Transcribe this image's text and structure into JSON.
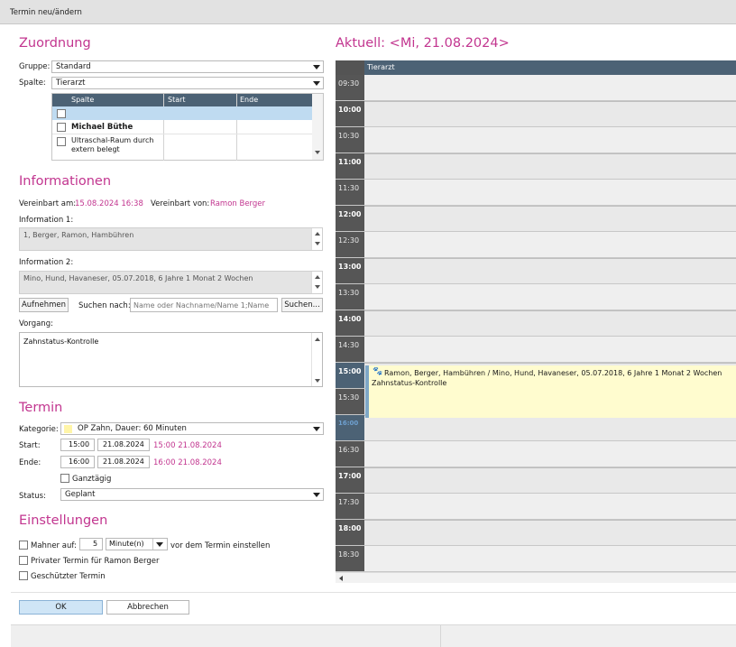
{
  "window": {
    "title": "Termin neu/ändern"
  },
  "zuordnung": {
    "heading": "Zuordnung",
    "gruppe_label": "Gruppe:",
    "gruppe_value": "Standard",
    "spalte_label": "Spalte:",
    "spalte_value": "Tierarzt",
    "table": {
      "headers": [
        "Spalte",
        "Start",
        "Ende"
      ],
      "rows": [
        {
          "name": "",
          "start": "",
          "ende": "",
          "checked": false,
          "selected": true,
          "bold": false
        },
        {
          "name": "Michael Büthe",
          "start": "",
          "ende": "",
          "checked": false,
          "selected": false,
          "bold": true
        },
        {
          "name": "Ultraschal-Raum durch extern belegt",
          "start": "",
          "ende": "",
          "checked": false,
          "selected": false,
          "bold": false
        }
      ]
    }
  },
  "informationen": {
    "heading": "Informationen",
    "vereinbart_am_label": "Vereinbart am:",
    "vereinbart_am_value": "15.08.2024 16:38",
    "vereinbart_von_label": "Vereinbart von:",
    "vereinbart_von_value": "Ramon Berger",
    "info1_label": "Information 1:",
    "info1_value": "1, Berger, Ramon, Hambühren",
    "info2_label": "Information 2:",
    "info2_value": "Mino, Hund, Havaneser, 05.07.2018, 6 Jahre 1 Monat 2 Wochen",
    "aufnehmen_label": "Aufnehmen",
    "suchen_nach_label": "Suchen nach:",
    "suchen_placeholder": "Name oder Nachname/Name 1;Name",
    "suchen_button": "Suchen...",
    "vorgang_label": "Vorgang:",
    "vorgang_value": "Zahnstatus-Kontrolle"
  },
  "termin": {
    "heading": "Termin",
    "kategorie_label": "Kategorie:",
    "kategorie_value": "OP Zahn, Dauer: 60 Minuten",
    "kategorie_color": "#fff5a8",
    "start_label": "Start:",
    "start_time": "15:00",
    "start_date": "21.08.2024",
    "start_summary": "15:00 21.08.2024",
    "ende_label": "Ende:",
    "ende_time": "16:00",
    "ende_date": "21.08.2024",
    "ende_summary": "16:00 21.08.2024",
    "ganztaegig_label": "Ganztägig",
    "ganztaegig_checked": false,
    "status_label": "Status:",
    "status_value": "Geplant"
  },
  "einstellungen": {
    "heading": "Einstellungen",
    "mahner_label": "Mahner auf:",
    "mahner_value": "5",
    "mahner_unit": "Minute(n)",
    "mahner_suffix": "vor dem Termin einstellen",
    "privat_label": "Privater Termin für Ramon Berger",
    "geschuetzt_label": "Geschützter Termin"
  },
  "buttons": {
    "ok": "OK",
    "abbrechen": "Abbrechen"
  },
  "calendar": {
    "heading": "Aktuell: <Mi, 21.08.2024>",
    "column_header": "Tierarzt",
    "times": [
      "09:30",
      "10:00",
      "10:30",
      "11:00",
      "11:30",
      "12:00",
      "12:30",
      "13:00",
      "13:30",
      "14:00",
      "14:30",
      "15:00",
      "15:30",
      "16:00",
      "16:30",
      "17:00",
      "17:30",
      "18:00",
      "18:30"
    ],
    "appointment": {
      "line1": "Ramon, Berger, Hambühren / Mino, Hund, Havaneser, 05.07.2018, 6 Jahre 1 Monat 2 Wochen",
      "line2": "Zahnstatus-Kontrolle",
      "icon": "paw-icon",
      "color": "#fffccf"
    }
  }
}
